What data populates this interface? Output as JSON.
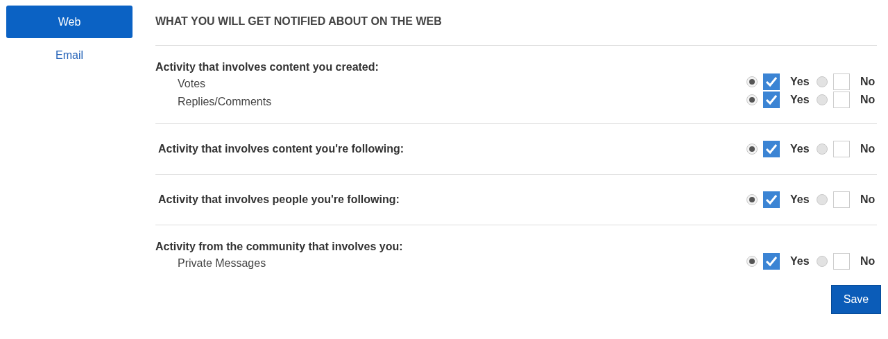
{
  "sidebar": {
    "items": [
      {
        "label": "Web",
        "selected": true
      },
      {
        "label": "Email",
        "selected": false
      }
    ]
  },
  "heading": "WHAT YOU WILL GET NOTIFIED ABOUT ON THE WEB",
  "sections": [
    {
      "title": "Activity that involves content you created:",
      "items": [
        {
          "label": "Votes",
          "options": [
            {
              "label": "Yes",
              "selected": true
            },
            {
              "label": "No",
              "selected": false
            }
          ]
        },
        {
          "label": "Replies/Comments",
          "options": [
            {
              "label": "Yes",
              "selected": true
            },
            {
              "label": "No",
              "selected": false
            }
          ]
        }
      ]
    },
    {
      "title": "Activity that involves content you're following:",
      "options": [
        {
          "label": "Yes",
          "selected": true
        },
        {
          "label": "No",
          "selected": false
        }
      ]
    },
    {
      "title": "Activity that involves people you're following:",
      "options": [
        {
          "label": "Yes",
          "selected": true
        },
        {
          "label": "No",
          "selected": false
        }
      ]
    },
    {
      "title": "Activity from the community that involves you:",
      "items": [
        {
          "label": "Private Messages",
          "options": [
            {
              "label": "Yes",
              "selected": true
            },
            {
              "label": "No",
              "selected": false
            }
          ]
        }
      ]
    }
  ],
  "save_button": "Save"
}
